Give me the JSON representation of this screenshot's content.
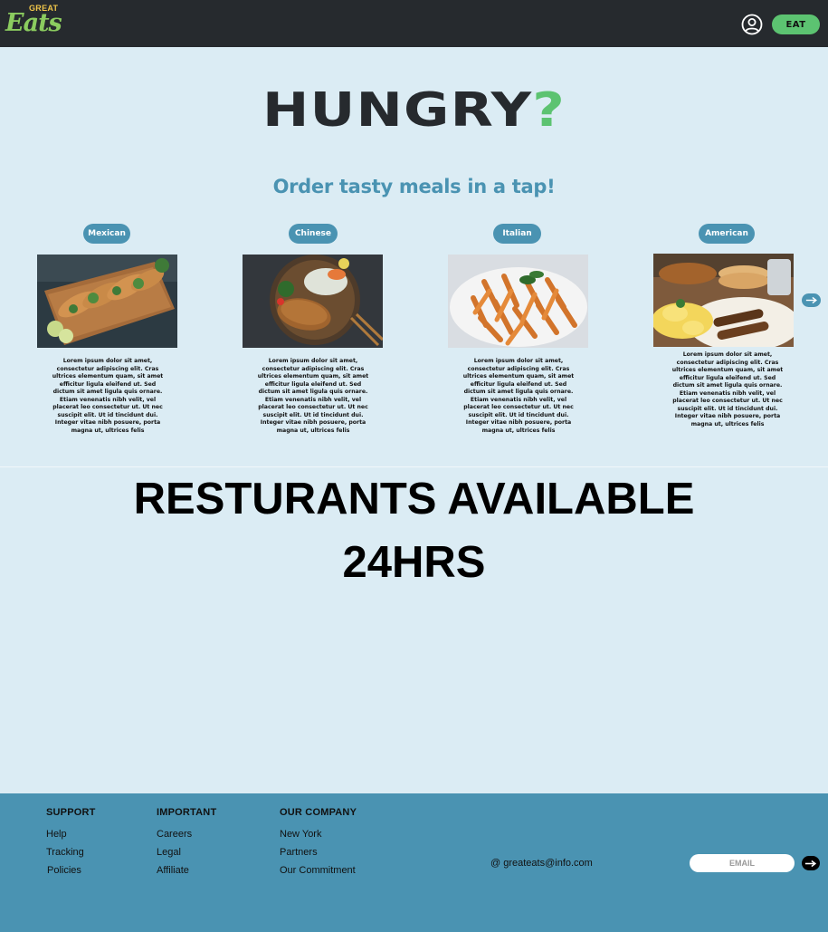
{
  "header": {
    "logo_top": "GREAT",
    "logo_main": "Eats",
    "cta_label": "EAT",
    "user_icon": "user-circle-icon"
  },
  "hero": {
    "title": "HUNGRY",
    "title_mark": "?",
    "tagline": "Order tasty meals in a tap!"
  },
  "cuisines": [
    {
      "label": "Mexican",
      "description": "Lorem ipsum dolor sit amet, consectetur adipiscing elit. Cras ultrices elementum quam, sit amet efficitur ligula eleifend ut. Sed dictum sit amet ligula quis ornare. Etiam venenatis nibh velit, vel placerat leo consectetur ut. Ut nec suscipit elit. Ut id tincidunt dui. Integer vitae nibh posuere, porta magna ut, ultrices felis"
    },
    {
      "label": "Chinese",
      "description": "Lorem ipsum dolor sit amet, consectetur adipiscing elit. Cras ultrices elementum quam, sit amet efficitur ligula eleifend ut. Sed dictum sit amet ligula quis ornare. Etiam venenatis nibh velit, vel placerat leo consectetur ut. Ut nec suscipit elit. Ut id tincidunt dui. Integer vitae nibh posuere, porta magna ut, ultrices felis"
    },
    {
      "label": "Italian",
      "description": "Lorem ipsum dolor sit amet, consectetur adipiscing elit. Cras ultrices elementum quam, sit amet efficitur ligula eleifend ut. Sed dictum sit amet ligula quis ornare. Etiam venenatis nibh velit, vel placerat leo consectetur ut. Ut nec suscipit elit. Ut id tincidunt dui. Integer vitae nibh posuere, porta magna ut, ultrices felis"
    },
    {
      "label": "American",
      "description": "Lorem ipsum dolor sit amet, consectetur adipiscing elit. Cras ultrices elementum quam, sit amet efficitur ligula eleifend ut. Sed dictum sit amet ligula quis ornare. Etiam venenatis nibh velit, vel placerat leo consectetur ut. Ut nec suscipit elit. Ut id tincidunt dui. Integer vitae nibh posuere, porta magna ut, ultrices felis"
    }
  ],
  "availability": {
    "line1": "RESTURANTS AVAILABLE",
    "line2": "24HRS"
  },
  "footer": {
    "support": {
      "heading": "SUPPORT",
      "links": [
        "Help",
        "Tracking",
        "Policies"
      ]
    },
    "important": {
      "heading": "IMPORTANT",
      "links": [
        "Careers",
        "Legal",
        "Affiliate"
      ]
    },
    "company": {
      "heading": "OUR COMPANY",
      "links": [
        "New York",
        "Partners",
        "Our Commitment"
      ]
    },
    "contact_email": "@ greateats@info.com",
    "email_placeholder": "EMAIL"
  },
  "colors": {
    "header_bg": "#262a2e",
    "page_bg": "#dbecf4",
    "accent_blue": "#4a93b2",
    "accent_green": "#5cc371"
  }
}
